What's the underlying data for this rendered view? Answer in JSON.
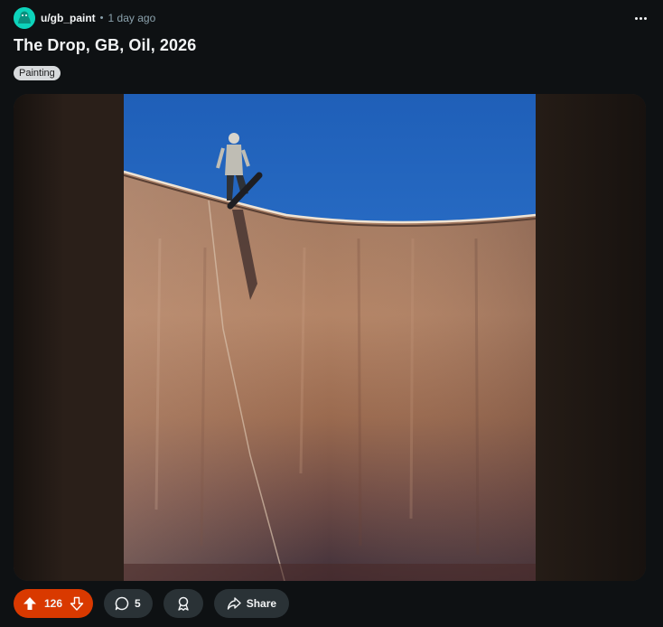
{
  "post": {
    "author": "u/gb_paint",
    "separator": "•",
    "time": "1 day ago",
    "title": "The Drop, GB, Oil, 2026",
    "flair": "Painting",
    "image_alt": "Oil painting of a skateboarder dropping into a large bowl under a blue sky"
  },
  "actions": {
    "upvote_count": "126",
    "comment_count": "5",
    "share_label": "Share"
  },
  "colors": {
    "background": "#0e1113",
    "vote_active": "#d93900",
    "pill": "#2a3236",
    "avatar": "#0dd3bb",
    "sky": "#2d6fc4"
  },
  "icons": [
    "more-horizontal-icon",
    "upvote-arrow-icon",
    "downvote-arrow-icon",
    "comment-bubble-icon",
    "award-icon",
    "share-arrow-icon"
  ]
}
